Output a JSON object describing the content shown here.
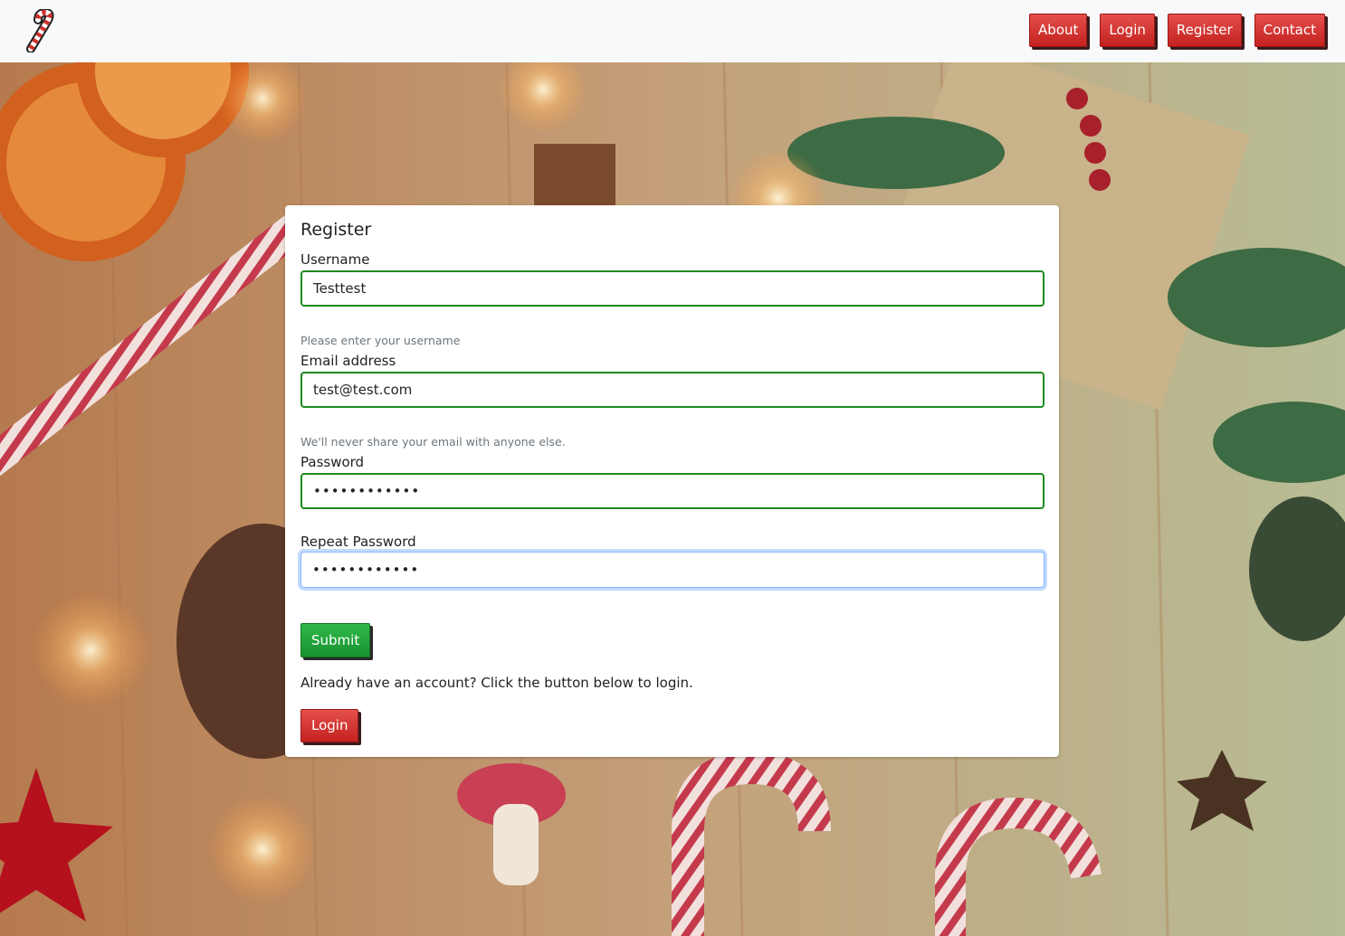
{
  "nav": {
    "logo_icon": "candy-cane-icon",
    "links": [
      "About",
      "Login",
      "Register",
      "Contact"
    ]
  },
  "form": {
    "title": "Register",
    "username": {
      "label": "Username",
      "value": "Testtest",
      "help": "Please enter your username"
    },
    "email": {
      "label": "Email address",
      "value": "test@test.com",
      "help": "We'll never share your email with anyone else."
    },
    "password": {
      "label": "Password",
      "value": "••••••••••••"
    },
    "repeat_password": {
      "label": "Repeat Password",
      "value": "••••••••••••"
    },
    "submit_label": "Submit",
    "login_note": "Already have an account? Click the button below to login.",
    "login_label": "Login"
  },
  "colors": {
    "nav_button": "#d0312d",
    "submit_button": "#1fa33a",
    "valid_border": "#1e8a1e",
    "focus_border": "#86b7fe"
  }
}
